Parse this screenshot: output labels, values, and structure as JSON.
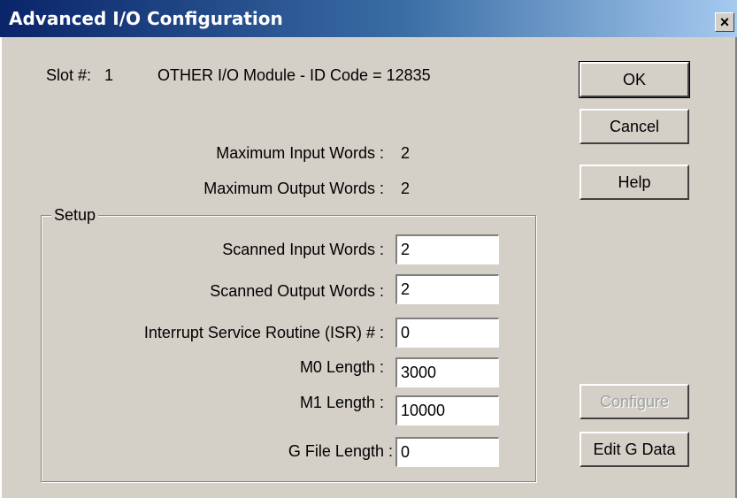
{
  "window": {
    "title": "Advanced I/O Configuration",
    "close_label": "×"
  },
  "slot": {
    "label": "Slot #:",
    "value": "1"
  },
  "module_text": "OTHER I/O Module - ID Code = 12835",
  "max_input": {
    "label": "Maximum Input Words :",
    "value": "2"
  },
  "max_output": {
    "label": "Maximum Output Words :",
    "value": "2"
  },
  "buttons": {
    "ok": "OK",
    "cancel": "Cancel",
    "help": "Help",
    "configure": "Configure",
    "edit_g_data": "Edit G Data"
  },
  "setup": {
    "group_label": "Setup",
    "fields": {
      "scanned_input": {
        "label": "Scanned Input Words :",
        "value": "2"
      },
      "scanned_output": {
        "label": "Scanned Output Words :",
        "value": "2"
      },
      "isr": {
        "label": "Interrupt Service Routine (ISR) # :",
        "value": "0"
      },
      "m0_length": {
        "label": "M0  Length :",
        "value": "3000"
      },
      "m1_length": {
        "label": "M1  Length :",
        "value": "10000"
      },
      "g_file_length": {
        "label": "G File Length :",
        "value": "0"
      }
    }
  }
}
